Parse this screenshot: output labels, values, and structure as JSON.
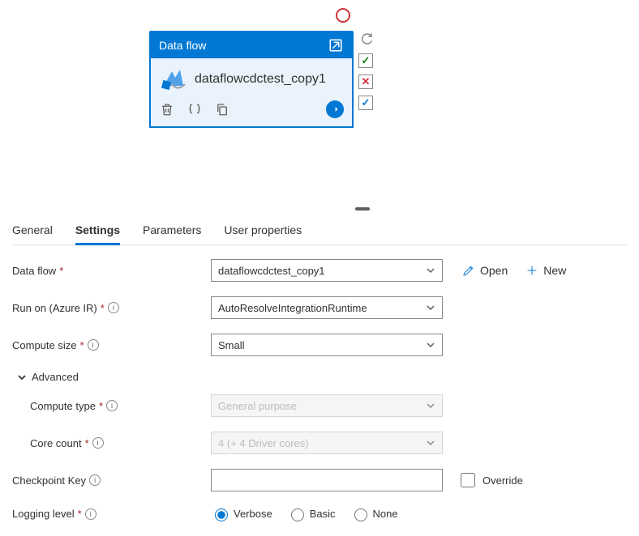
{
  "card": {
    "title": "Data flow",
    "activity_name": "dataflowcdctest_copy1"
  },
  "tabs": {
    "general": "General",
    "settings": "Settings",
    "parameters": "Parameters",
    "user_properties": "User properties"
  },
  "form": {
    "dataflow_label": "Data flow",
    "dataflow_value": "dataflowcdctest_copy1",
    "open_label": "Open",
    "new_label": "New",
    "runon_label": "Run on (Azure IR)",
    "runon_value": "AutoResolveIntegrationRuntime",
    "computesize_label": "Compute size",
    "computesize_value": "Small",
    "advanced_label": "Advanced",
    "computetype_label": "Compute type",
    "computetype_value": "General purpose",
    "corecount_label": "Core count",
    "corecount_value": "4 (+ 4 Driver cores)",
    "checkpoint_label": "Checkpoint Key",
    "checkpoint_value": "",
    "override_label": "Override",
    "logging_label": "Logging level",
    "logging_verbose": "Verbose",
    "logging_basic": "Basic",
    "logging_none": "None"
  }
}
